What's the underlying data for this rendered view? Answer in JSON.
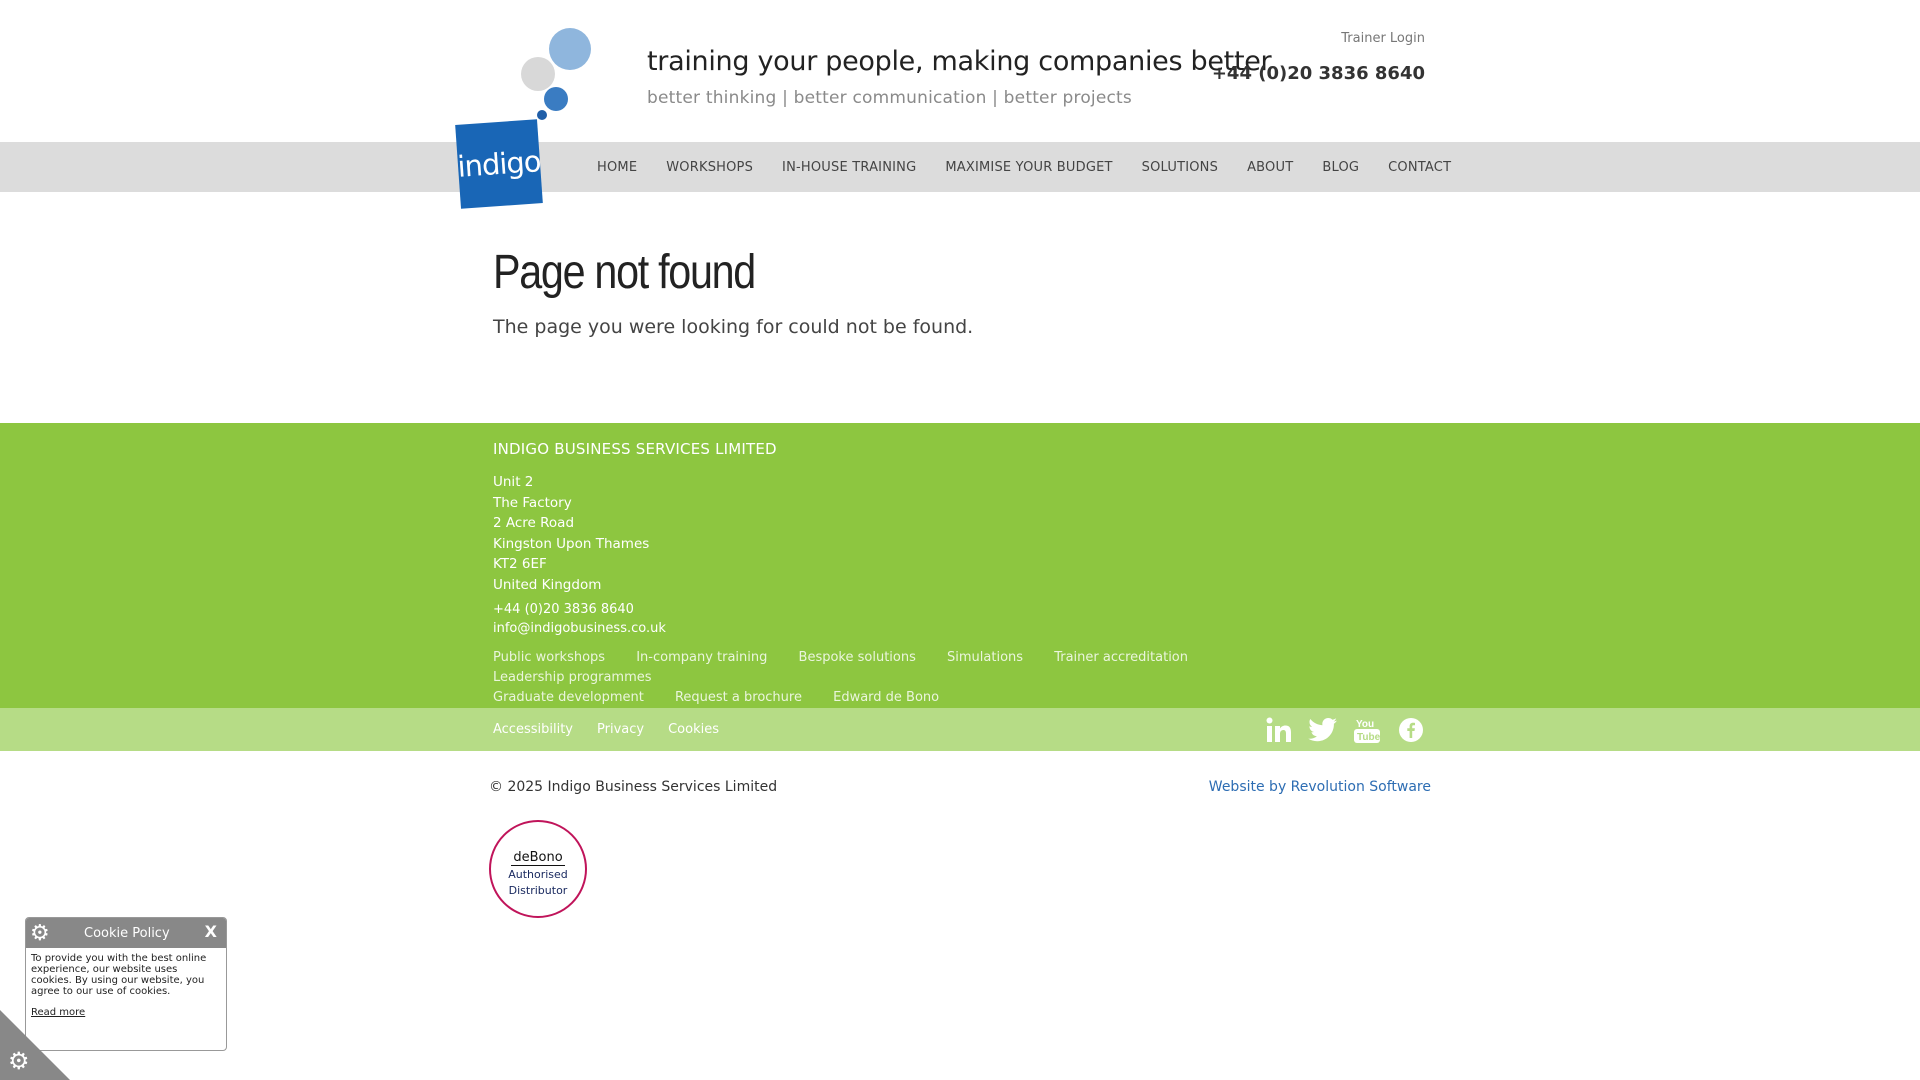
{
  "header": {
    "logo_text": "indigo",
    "tagline": "training your people, making companies better",
    "subtagline": "better thinking | better communication | better projects",
    "trainer_login": "Trainer Login",
    "phone": "+44 (0)20 3836 8640"
  },
  "nav": {
    "items": [
      "HOME",
      "WORKSHOPS",
      "IN-HOUSE TRAINING",
      "MAXIMISE YOUR BUDGET",
      "SOLUTIONS",
      "ABOUT",
      "BLOG",
      "CONTACT"
    ]
  },
  "main": {
    "title": "Page not found",
    "message": "The page you were looking for could not be found."
  },
  "footer": {
    "company": "INDIGO BUSINESS SERVICES LIMITED",
    "address": [
      "Unit 2",
      "The Factory",
      "2 Acre Road",
      "Kingston Upon Thames",
      "KT2 6EF",
      "United Kingdom"
    ],
    "phone": "+44 (0)20 3836 8640",
    "email": "info@indigobusiness.co.uk",
    "links": [
      "Public workshops",
      "In-company training",
      "Bespoke solutions",
      "Simulations",
      "Trainer accreditation",
      "Leadership programmes",
      "Graduate development",
      "Request a brochure",
      "Edward de Bono"
    ],
    "legal": [
      "Accessibility",
      "Privacy",
      "Cookies"
    ],
    "social": [
      "linkedin-icon",
      "twitter-icon",
      "youtube-icon",
      "facebook-icon"
    ],
    "copyright": "© 2025 Indigo Business Services Limited",
    "credit": "Website by Revolution Software"
  },
  "badge": {
    "brand": "deBono",
    "line1": "Authorised",
    "line2": "Distributor"
  },
  "cookie": {
    "title": "Cookie Policy",
    "close": "X",
    "text": "To provide you with the best online experience, our website uses cookies. By using our website, you agree to our use of cookies.",
    "read_more": "Read more"
  },
  "colors": {
    "green": "#8dc640",
    "light_green": "#b6dc86",
    "brand_blue": "#1966b6"
  }
}
